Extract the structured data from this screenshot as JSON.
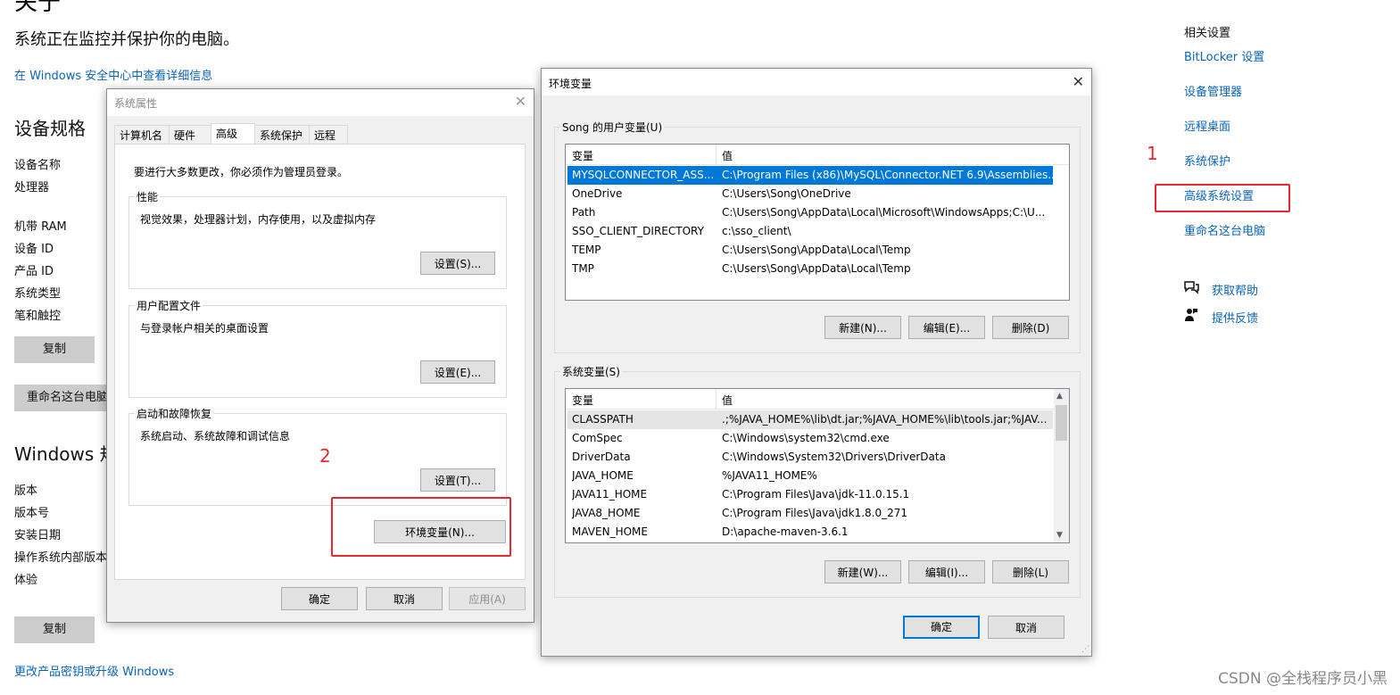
{
  "background": {
    "title": "关于",
    "status": "系统正在监控并保护你的电脑。",
    "security_link": "在 Windows 安全中心中查看详细信息",
    "device_specs_heading": "设备规格",
    "device_labels": [
      "设备名称",
      "处理器",
      "机带 RAM",
      "设备 ID",
      "产品 ID",
      "系统类型",
      "笔和触控"
    ],
    "copy_button": "复制",
    "rename_button": "重命名这台电脑",
    "windows_specs_heading": "Windows 规",
    "windows_labels": [
      "版本",
      "版本号",
      "安装日期",
      "操作系统内部版本",
      "体验"
    ],
    "copy_button_2": "复制",
    "product_key_link": "更改产品密钥或升级 Windows"
  },
  "related": {
    "heading": "相关设置",
    "links": [
      "BitLocker 设置",
      "设备管理器",
      "远程桌面",
      "系统保护",
      "高级系统设置",
      "重命名这台电脑"
    ],
    "help": "获取帮助",
    "feedback": "提供反馈"
  },
  "annotations": {
    "one": "1",
    "two": "2"
  },
  "sysprops": {
    "title": "系统属性",
    "tabs": [
      "计算机名",
      "硬件",
      "高级",
      "系统保护",
      "远程"
    ],
    "admin_note": "要进行大多数更改，你必须作为管理员登录。",
    "perf_label": "性能",
    "perf_desc": "视觉效果，处理器计划，内存使用，以及虚拟内存",
    "perf_btn": "设置(S)...",
    "profile_label": "用户配置文件",
    "profile_desc": "与登录帐户相关的桌面设置",
    "profile_btn": "设置(E)...",
    "startup_label": "启动和故障恢复",
    "startup_desc": "系统启动、系统故障和调试信息",
    "startup_btn": "设置(T)...",
    "env_btn": "环境变量(N)...",
    "ok": "确定",
    "cancel": "取消",
    "apply": "应用(A)"
  },
  "envvars": {
    "title": "环境变量",
    "user_group": "Song 的用户变量(U)",
    "col_var": "变量",
    "col_val": "值",
    "user_rows": [
      {
        "name": "MYSQLCONNECTOR_ASS...",
        "value": "C:\\Program Files (x86)\\MySQL\\Connector.NET 6.9\\Assemblies..."
      },
      {
        "name": "OneDrive",
        "value": "C:\\Users\\Song\\OneDrive"
      },
      {
        "name": "Path",
        "value": "C:\\Users\\Song\\AppData\\Local\\Microsoft\\WindowsApps;C:\\U..."
      },
      {
        "name": "SSO_CLIENT_DIRECTORY",
        "value": "c:\\sso_client\\"
      },
      {
        "name": "TEMP",
        "value": "C:\\Users\\Song\\AppData\\Local\\Temp"
      },
      {
        "name": "TMP",
        "value": "C:\\Users\\Song\\AppData\\Local\\Temp"
      }
    ],
    "user_new": "新建(N)...",
    "user_edit": "编辑(E)...",
    "user_delete": "删除(D)",
    "sys_group": "系统变量(S)",
    "sys_rows": [
      {
        "name": "CLASSPATH",
        "value": ".;%JAVA_HOME%\\lib\\dt.jar;%JAVA_HOME%\\lib\\tools.jar;%JAV..."
      },
      {
        "name": "ComSpec",
        "value": "C:\\Windows\\system32\\cmd.exe"
      },
      {
        "name": "DriverData",
        "value": "C:\\Windows\\System32\\Drivers\\DriverData"
      },
      {
        "name": "JAVA_HOME",
        "value": "%JAVA11_HOME%"
      },
      {
        "name": "JAVA11_HOME",
        "value": "C:\\Program Files\\Java\\jdk-11.0.15.1"
      },
      {
        "name": "JAVA8_HOME",
        "value": "C:\\Program Files\\Java\\jdk1.8.0_271"
      },
      {
        "name": "MAVEN_HOME",
        "value": "D:\\apache-maven-3.6.1"
      }
    ],
    "sys_new": "新建(W)...",
    "sys_edit": "编辑(I)...",
    "sys_delete": "删除(L)",
    "ok": "确定",
    "cancel": "取消"
  },
  "watermark": "CSDN @全栈程序员小黑",
  "colors": {
    "link": "#0a64b8",
    "annotation": "#e8282e",
    "selection": "#0078d7"
  }
}
